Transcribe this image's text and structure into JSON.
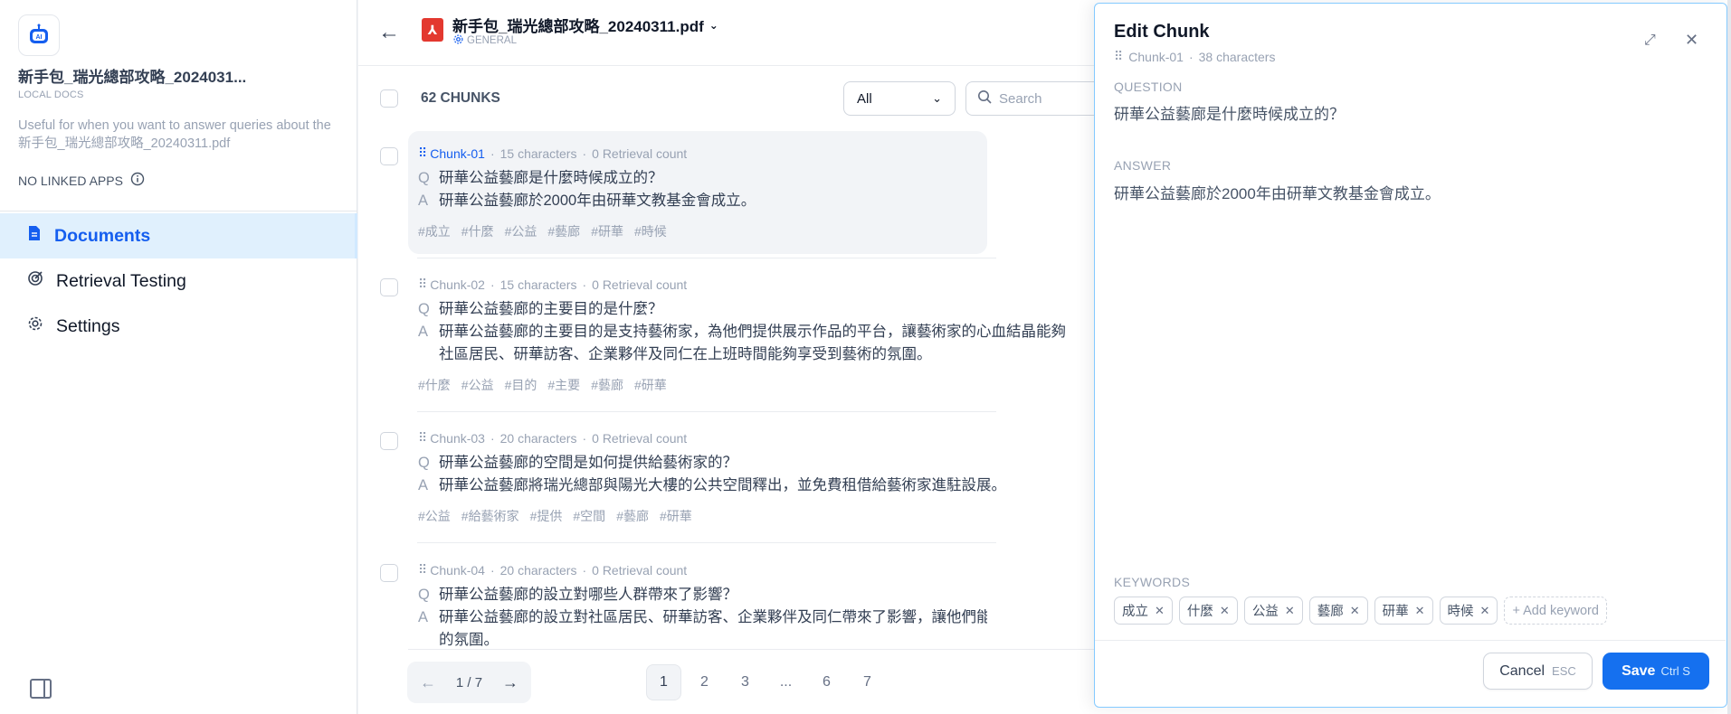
{
  "app": {
    "icon": "ai-robot-icon",
    "title": "新手包_瑞光總部攻略_2024031...",
    "subtitle": "LOCAL DOCS",
    "description": "Useful for when you want to answer queries about the 新手包_瑞光總部攻略_20240311.pdf",
    "linked_apps": "NO LINKED APPS"
  },
  "nav": {
    "documents": "Documents",
    "retrieval_testing": "Retrieval Testing",
    "settings": "Settings"
  },
  "document": {
    "name": "新手包_瑞光總部攻略_20240311.pdf",
    "mode": "GENERAL"
  },
  "toolbar": {
    "chunks_count": "62 CHUNKS",
    "filter_value": "All",
    "search_placeholder": "Search"
  },
  "chunks": [
    {
      "id": "Chunk-01",
      "chars": "15 characters",
      "retrieval": "0 Retrieval count",
      "q": "研華公益藝廊是什麼時候成立的？",
      "a": "研華公益藝廊於2000年由研華文教基金會成立。",
      "a2": "",
      "tags": [
        "#成立",
        "#什麼",
        "#公益",
        "#藝廊",
        "#研華",
        "#時候"
      ]
    },
    {
      "id": "Chunk-02",
      "chars": "15 characters",
      "retrieval": "0 Retrieval count",
      "q": "研華公益藝廊的主要目的是什麼？",
      "a": "研華公益藝廊的主要目的是支持藝術家，為他們提供展示作品的平台，讓藝術家的心血結晶能夠",
      "a2": "社區居民、研華訪客、企業夥伴及同仁在上班時間能夠享受到藝術的氛圍。",
      "tags": [
        "#什麼",
        "#公益",
        "#目的",
        "#主要",
        "#藝廊",
        "#研華"
      ]
    },
    {
      "id": "Chunk-03",
      "chars": "20 characters",
      "retrieval": "0 Retrieval count",
      "q": "研華公益藝廊的空間是如何提供給藝術家的？",
      "a": "研華公益藝廊將瑞光總部與陽光大樓的公共空間釋出，並免費租借給藝術家進駐設展。",
      "a2": "",
      "tags": [
        "#公益",
        "#給藝術家",
        "#提供",
        "#空間",
        "#藝廊",
        "#研華"
      ]
    },
    {
      "id": "Chunk-04",
      "chars": "20 characters",
      "retrieval": "0 Retrieval count",
      "q": "研華公益藝廊的設立對哪些人群帶來了影響？",
      "a": "研華公益藝廊的設立對社區居民、研華訪客、企業夥伴及同仁帶來了影響，讓他們能在日常生活",
      "a2": "的氛圍。",
      "tags": []
    }
  ],
  "pagination": {
    "current": "1 / 7",
    "pages": [
      "1",
      "2",
      "3",
      "...",
      "6",
      "7"
    ]
  },
  "edit_panel": {
    "title": "Edit Chunk",
    "chunk_id": "Chunk-01",
    "chars": "38 characters",
    "question_label": "QUESTION",
    "question": "研華公益藝廊是什麼時候成立的？",
    "answer_label": "ANSWER",
    "answer": "研華公益藝廊於2000年由研華文教基金會成立。",
    "keywords_label": "KEYWORDS",
    "keywords": [
      "成立",
      "什麼",
      "公益",
      "藝廊",
      "研華",
      "時候"
    ],
    "add_keyword": "+ Add keyword",
    "cancel": "Cancel",
    "cancel_kbd": "ESC",
    "save": "Save",
    "save_kbd": "Ctrl S"
  },
  "colors": {
    "accent": "#1570ef",
    "active_nav_bg": "#e0f0fd",
    "pdf_red": "#e3382f"
  }
}
